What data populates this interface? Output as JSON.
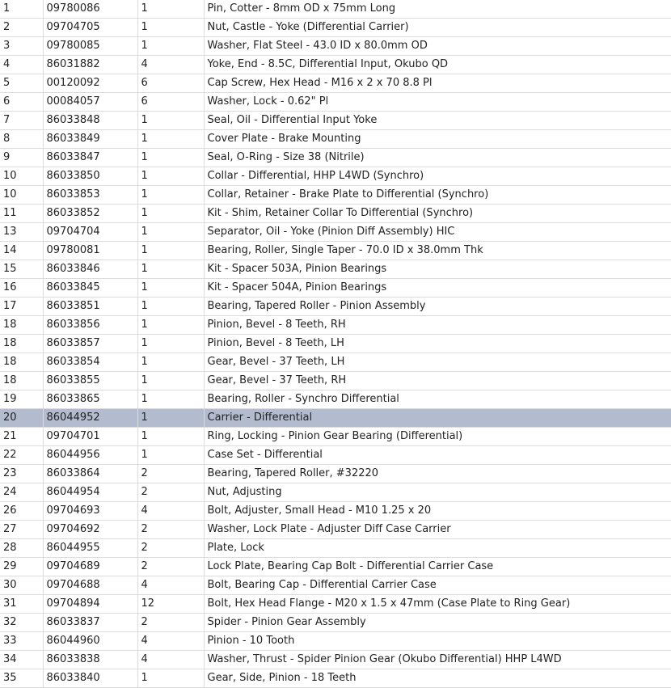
{
  "parts_table": {
    "selected_index": 22,
    "rows": [
      {
        "ref": "1",
        "part": "09780086",
        "qty": "1",
        "desc": "Pin, Cotter - 8mm OD x 75mm Long"
      },
      {
        "ref": "2",
        "part": "09704705",
        "qty": "1",
        "desc": "Nut, Castle - Yoke (Differential Carrier)"
      },
      {
        "ref": "3",
        "part": "09780085",
        "qty": "1",
        "desc": "Washer, Flat Steel - 43.0 ID x 80.0mm OD"
      },
      {
        "ref": "4",
        "part": "86031882",
        "qty": "4",
        "desc": "Yoke, End - 8.5C, Differential Input, Okubo QD"
      },
      {
        "ref": "5",
        "part": "00120092",
        "qty": "6",
        "desc": "Cap Screw, Hex Head - M16 x 2 x 70 8.8 Pl"
      },
      {
        "ref": "6",
        "part": "00084057",
        "qty": "6",
        "desc": "Washer, Lock - 0.62\" Pl"
      },
      {
        "ref": "7",
        "part": "86033848",
        "qty": "1",
        "desc": "Seal, Oil - Differential Input Yoke"
      },
      {
        "ref": "8",
        "part": "86033849",
        "qty": "1",
        "desc": "Cover Plate - Brake Mounting"
      },
      {
        "ref": "9",
        "part": "86033847",
        "qty": "1",
        "desc": "Seal, O-Ring - Size 38 (Nitrile)"
      },
      {
        "ref": "10",
        "part": "86033850",
        "qty": "1",
        "desc": "Collar - Differential, HHP L4WD (Synchro)"
      },
      {
        "ref": "10",
        "part": "86033853",
        "qty": "1",
        "desc": "Collar, Retainer - Brake Plate to Differential (Synchro)"
      },
      {
        "ref": "11",
        "part": "86033852",
        "qty": "1",
        "desc": "Kit - Shim, Retainer Collar To Differential (Synchro)"
      },
      {
        "ref": "13",
        "part": "09704704",
        "qty": "1",
        "desc": "Separator, Oil - Yoke (Pinion Diff Assembly) HIC"
      },
      {
        "ref": "14",
        "part": "09780081",
        "qty": "1",
        "desc": "Bearing, Roller, Single Taper - 70.0 ID x 38.0mm Thk"
      },
      {
        "ref": "15",
        "part": "86033846",
        "qty": "1",
        "desc": "Kit - Spacer 503A, Pinion Bearings"
      },
      {
        "ref": "16",
        "part": "86033845",
        "qty": "1",
        "desc": "Kit - Spacer 504A, Pinion Bearings"
      },
      {
        "ref": "17",
        "part": "86033851",
        "qty": "1",
        "desc": "Bearing, Tapered Roller - Pinion Assembly"
      },
      {
        "ref": "18",
        "part": "86033856",
        "qty": "1",
        "desc": "Pinion, Bevel - 8 Teeth, RH"
      },
      {
        "ref": "18",
        "part": "86033857",
        "qty": "1",
        "desc": "Pinion, Bevel - 8 Teeth, LH"
      },
      {
        "ref": "18",
        "part": "86033854",
        "qty": "1",
        "desc": "Gear, Bevel - 37 Teeth, LH"
      },
      {
        "ref": "18",
        "part": "86033855",
        "qty": "1",
        "desc": "Gear, Bevel - 37 Teeth, RH"
      },
      {
        "ref": "19",
        "part": "86033865",
        "qty": "1",
        "desc": "Bearing, Roller - Synchro Differential"
      },
      {
        "ref": "20",
        "part": "86044952",
        "qty": "1",
        "desc": "Carrier - Differential"
      },
      {
        "ref": "21",
        "part": "09704701",
        "qty": "1",
        "desc": "Ring, Locking - Pinion Gear Bearing (Differential)"
      },
      {
        "ref": "22",
        "part": "86044956",
        "qty": "1",
        "desc": "Case Set - Differential"
      },
      {
        "ref": "23",
        "part": "86033864",
        "qty": "2",
        "desc": "Bearing, Tapered Roller, #32220"
      },
      {
        "ref": "24",
        "part": "86044954",
        "qty": "2",
        "desc": "Nut, Adjusting"
      },
      {
        "ref": "26",
        "part": "09704693",
        "qty": "4",
        "desc": "Bolt, Adjuster, Small Head - M10 1.25 x 20"
      },
      {
        "ref": "27",
        "part": "09704692",
        "qty": "2",
        "desc": "Washer, Lock Plate - Adjuster Diff Case Carrier"
      },
      {
        "ref": "28",
        "part": "86044955",
        "qty": "2",
        "desc": "Plate, Lock"
      },
      {
        "ref": "29",
        "part": "09704689",
        "qty": "2",
        "desc": "Lock Plate, Bearing Cap Bolt - Differential Carrier Case"
      },
      {
        "ref": "30",
        "part": "09704688",
        "qty": "4",
        "desc": "Bolt, Bearing Cap - Differential Carrier Case"
      },
      {
        "ref": "31",
        "part": "09704894",
        "qty": "12",
        "desc": "Bolt, Hex Head Flange - M20 x 1.5 x 47mm (Case Plate to Ring Gear)"
      },
      {
        "ref": "32",
        "part": "86033837",
        "qty": "2",
        "desc": "Spider - Pinion Gear Assembly"
      },
      {
        "ref": "33",
        "part": "86044960",
        "qty": "4",
        "desc": "Pinion - 10 Tooth"
      },
      {
        "ref": "34",
        "part": "86033838",
        "qty": "4",
        "desc": "Washer, Thrust - Spider Pinion Gear (Okubo Differential) HHP L4WD"
      },
      {
        "ref": "35",
        "part": "86033840",
        "qty": "1",
        "desc": "Gear, Side, Pinion - 18 Teeth"
      }
    ]
  }
}
